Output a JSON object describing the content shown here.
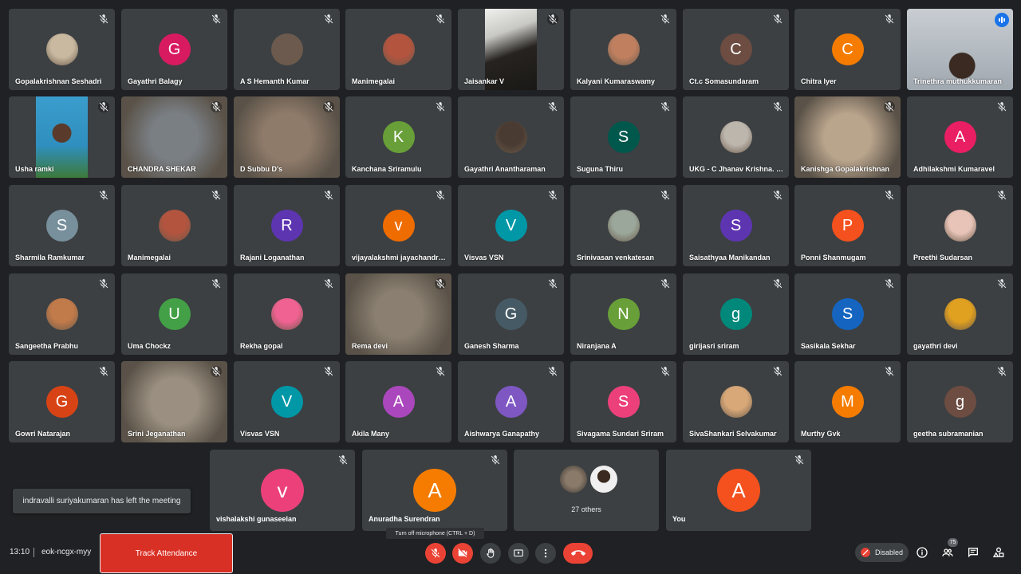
{
  "participants": [
    {
      "name": "Gopalakrishnan Seshadri",
      "letter": "",
      "color": "#c9b9a0",
      "kind": "photo"
    },
    {
      "name": "Gayathri Balagy",
      "letter": "G",
      "color": "#d81b60",
      "kind": "letter"
    },
    {
      "name": "A S Hemanth Kumar",
      "letter": "",
      "color": "#6d5a4e",
      "kind": "photo"
    },
    {
      "name": "Manimegalai",
      "letter": "",
      "color": "#b3543f",
      "kind": "photo"
    },
    {
      "name": "Jaisankar V",
      "letter": "",
      "color": "#2d2a26",
      "kind": "video"
    },
    {
      "name": "Kalyani Kumaraswamy",
      "letter": "",
      "color": "#c08060",
      "kind": "photo"
    },
    {
      "name": "Ct.c Somasundaram",
      "letter": "C",
      "color": "#6d4c41",
      "kind": "letter"
    },
    {
      "name": "Chitra Iyer",
      "letter": "C",
      "color": "#f57c00",
      "kind": "letter"
    },
    {
      "name": "Trinethra muthukkumaran",
      "letter": "",
      "color": "#9fa8b0",
      "kind": "video"
    },
    {
      "name": "Usha ramki",
      "letter": "",
      "color": "#3a8fb5",
      "kind": "video"
    },
    {
      "name": "CHANDRA SHEKAR",
      "letter": "",
      "color": "#7a7f84",
      "kind": "video"
    },
    {
      "name": "D Subbu D's",
      "letter": "",
      "color": "#8f7b6a",
      "kind": "video"
    },
    {
      "name": "Kanchana Sriramulu",
      "letter": "K",
      "color": "#689f38",
      "kind": "letter"
    },
    {
      "name": "Gayathri Anantharaman",
      "letter": "",
      "color": "#4a3b32",
      "kind": "photo"
    },
    {
      "name": "Suguna Thiru",
      "letter": "S",
      "color": "#00574b",
      "kind": "letter"
    },
    {
      "name": "UKG - C Jhanav Krishna. S...",
      "letter": "",
      "color": "#bdb6ad",
      "kind": "photo"
    },
    {
      "name": "Kanishga Gopalakrishnan",
      "letter": "",
      "color": "#b9a48c",
      "kind": "video"
    },
    {
      "name": "Adhilakshmi Kumaravel",
      "letter": "A",
      "color": "#e91e63",
      "kind": "letter"
    },
    {
      "name": "Sharmila Ramkumar",
      "letter": "S",
      "color": "#78909c",
      "kind": "letter"
    },
    {
      "name": "Manimegalai",
      "letter": "",
      "color": "#b3543f",
      "kind": "photo"
    },
    {
      "name": "Rajani Loganathan",
      "letter": "R",
      "color": "#5e35b1",
      "kind": "letter"
    },
    {
      "name": "vijayalakshmi jayachandran",
      "letter": "v",
      "color": "#ef6c00",
      "kind": "letter"
    },
    {
      "name": "Visvas VSN",
      "letter": "V",
      "color": "#0097a7",
      "kind": "letter"
    },
    {
      "name": "Srinivasan venkatesan",
      "letter": "",
      "color": "#9aa79a",
      "kind": "photo"
    },
    {
      "name": "Saisathyaa Manikandan",
      "letter": "S",
      "color": "#5e35b1",
      "kind": "letter"
    },
    {
      "name": "Ponni Shanmugam",
      "letter": "P",
      "color": "#f4511e",
      "kind": "letter"
    },
    {
      "name": "Preethi Sudarsan",
      "letter": "",
      "color": "#e8c4b8",
      "kind": "photo"
    },
    {
      "name": "Sangeetha Prabhu",
      "letter": "",
      "color": "#c17a4a",
      "kind": "photo"
    },
    {
      "name": "Uma Chockz",
      "letter": "U",
      "color": "#43a047",
      "kind": "letter"
    },
    {
      "name": "Rekha gopal",
      "letter": "",
      "color": "#f06292",
      "kind": "photo"
    },
    {
      "name": "Rema devi",
      "letter": "",
      "color": "#8a7f70",
      "kind": "video"
    },
    {
      "name": "Ganesh Sharma",
      "letter": "G",
      "color": "#455a64",
      "kind": "letter"
    },
    {
      "name": "Niranjana A",
      "letter": "N",
      "color": "#689f38",
      "kind": "letter"
    },
    {
      "name": "girijasri sriram",
      "letter": "g",
      "color": "#00897b",
      "kind": "letter"
    },
    {
      "name": "Sasikala Sekhar",
      "letter": "S",
      "color": "#1565c0",
      "kind": "letter"
    },
    {
      "name": "gayathri devi",
      "letter": "",
      "color": "#e0a020",
      "kind": "photo"
    },
    {
      "name": "Gowri Natarajan",
      "letter": "G",
      "color": "#d84315",
      "kind": "letter"
    },
    {
      "name": "Srini Jeganathan",
      "letter": "",
      "color": "#9a8f80",
      "kind": "video"
    },
    {
      "name": "Visvas VSN",
      "letter": "V",
      "color": "#0097a7",
      "kind": "letter"
    },
    {
      "name": "Akila Many",
      "letter": "A",
      "color": "#ab47bc",
      "kind": "letter"
    },
    {
      "name": "Aishwarya Ganapathy",
      "letter": "A",
      "color": "#7e57c2",
      "kind": "letter"
    },
    {
      "name": "Sivagama Sundari Sriram",
      "letter": "S",
      "color": "#ec407a",
      "kind": "letter"
    },
    {
      "name": "SivaShankari Selvakumar",
      "letter": "",
      "color": "#d8a878",
      "kind": "photo"
    },
    {
      "name": "Murthy Gvk",
      "letter": "M",
      "color": "#f57c00",
      "kind": "letter"
    },
    {
      "name": "geetha subramanian",
      "letter": "g",
      "color": "#6d4c41",
      "kind": "letter"
    }
  ],
  "bottom_row": [
    {
      "name": "vishalakshi gunaseelan",
      "letter": "v",
      "color": "#ec407a"
    },
    {
      "name": "Anuradha Surendran",
      "letter": "A",
      "color": "#f57c00"
    },
    {
      "name": "",
      "label": "27 others"
    },
    {
      "name": "You",
      "letter": "A",
      "color": "#f4511e"
    }
  ],
  "toast": "indravalli suriyakumaran has left the meeting",
  "tooltip": "Turn off microphone (CTRL + D)",
  "meeting": {
    "time": "13:10",
    "code": "eok-ncgx-myy"
  },
  "track_attendance": "Track Attendance",
  "disabled_label": "Disabled",
  "people_count": "75",
  "icons": {
    "mic_off": "mic-off-icon",
    "cam_off": "camera-off-icon",
    "hand": "raise-hand-icon",
    "present": "present-screen-icon",
    "more": "more-options-icon",
    "end": "end-call-icon",
    "info": "info-icon",
    "people": "people-icon",
    "chat": "chat-icon",
    "activities": "activities-icon"
  }
}
